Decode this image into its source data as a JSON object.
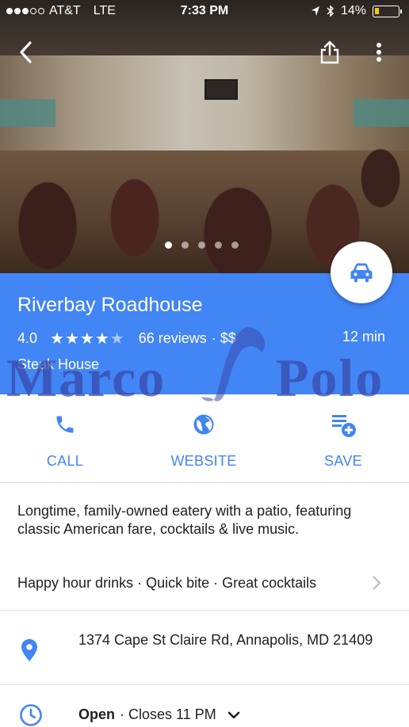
{
  "status_bar": {
    "carrier": "AT&T",
    "network": "LTE",
    "time": "7:33 PM",
    "battery": "14%",
    "signal_bars_filled": 3,
    "signal_bars_total": 5,
    "battery_level": 0.14
  },
  "hero": {
    "photo_count": 5,
    "active_photo": 1
  },
  "place": {
    "name": "Riverbay Roadhouse",
    "rating": "4.0",
    "rating_value": 4.0,
    "reviews": "66 reviews",
    "price": "· $$",
    "category": "Steak House",
    "eta": "12 min"
  },
  "actions": {
    "call": "CALL",
    "website": "WEBSITE",
    "save": "SAVE"
  },
  "description": "Longtime, family-owned eatery with a patio, featuring classic American fare, cocktails & live music.",
  "tags": "Happy hour drinks · Quick bite · Great cocktails",
  "address": "1374 Cape St Claire Rd, Annapolis, MD 21409",
  "hours": {
    "status": "Open",
    "closes": "· Closes 11 PM"
  },
  "watermark": {
    "word1": "Marco",
    "word2": "Polo"
  },
  "colors": {
    "accent": "#4285f4",
    "text": "#212121",
    "divider": "#e0e0e0"
  }
}
